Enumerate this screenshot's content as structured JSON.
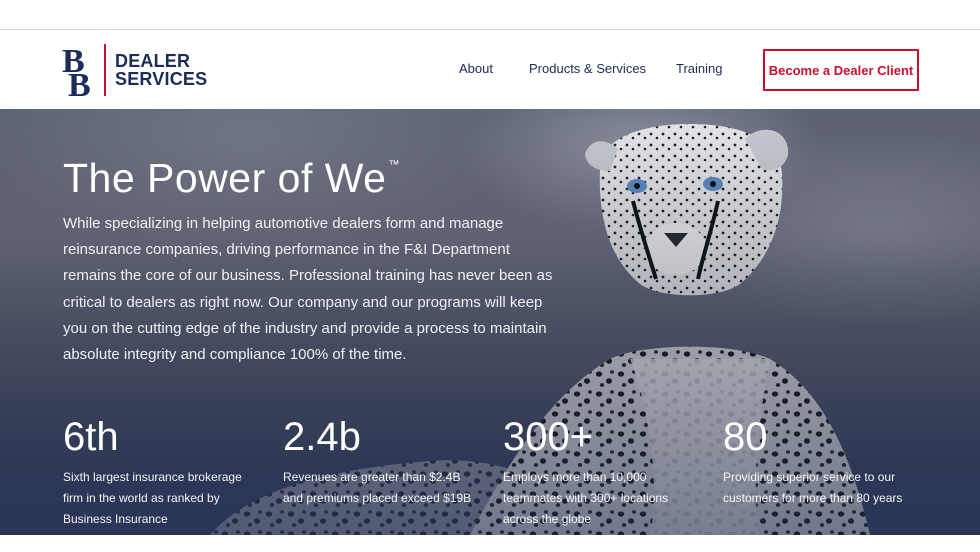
{
  "brand": {
    "mark": "BB",
    "line1": "DEALER",
    "line2": "SERVICES",
    "accent_color": "#c8102e",
    "navy_color": "#1c2b57"
  },
  "nav": {
    "links": [
      {
        "label": "About"
      },
      {
        "label": "Products & Services"
      },
      {
        "label": "Training"
      }
    ],
    "cta_label": "Become a Dealer Client"
  },
  "hero": {
    "title": "The Power of We",
    "trademark": "™",
    "body": "While specializing in helping automotive dealers form and manage reinsurance companies, driving performance in the F&I Department remains the core of our business. Professional training has never been as critical to dealers as right now. Our company and our programs will keep you on the cutting edge of the industry and provide a process to maintain absolute integrity and compliance 100% of the time.",
    "image": "cheetah-photo"
  },
  "stats": [
    {
      "value": "6th",
      "desc": "Sixth largest insurance brokerage firm in the world as ranked by Business Insurance"
    },
    {
      "value": "2.4b",
      "desc": "Revenues are greater than $2.4B and premiums placed exceed $19B"
    },
    {
      "value": "300+",
      "desc": "Employs more than 10,000 teammates with 300+ locations across the globe"
    },
    {
      "value": "80",
      "desc": "Providing superior service to our customers for more than 80 years"
    }
  ]
}
